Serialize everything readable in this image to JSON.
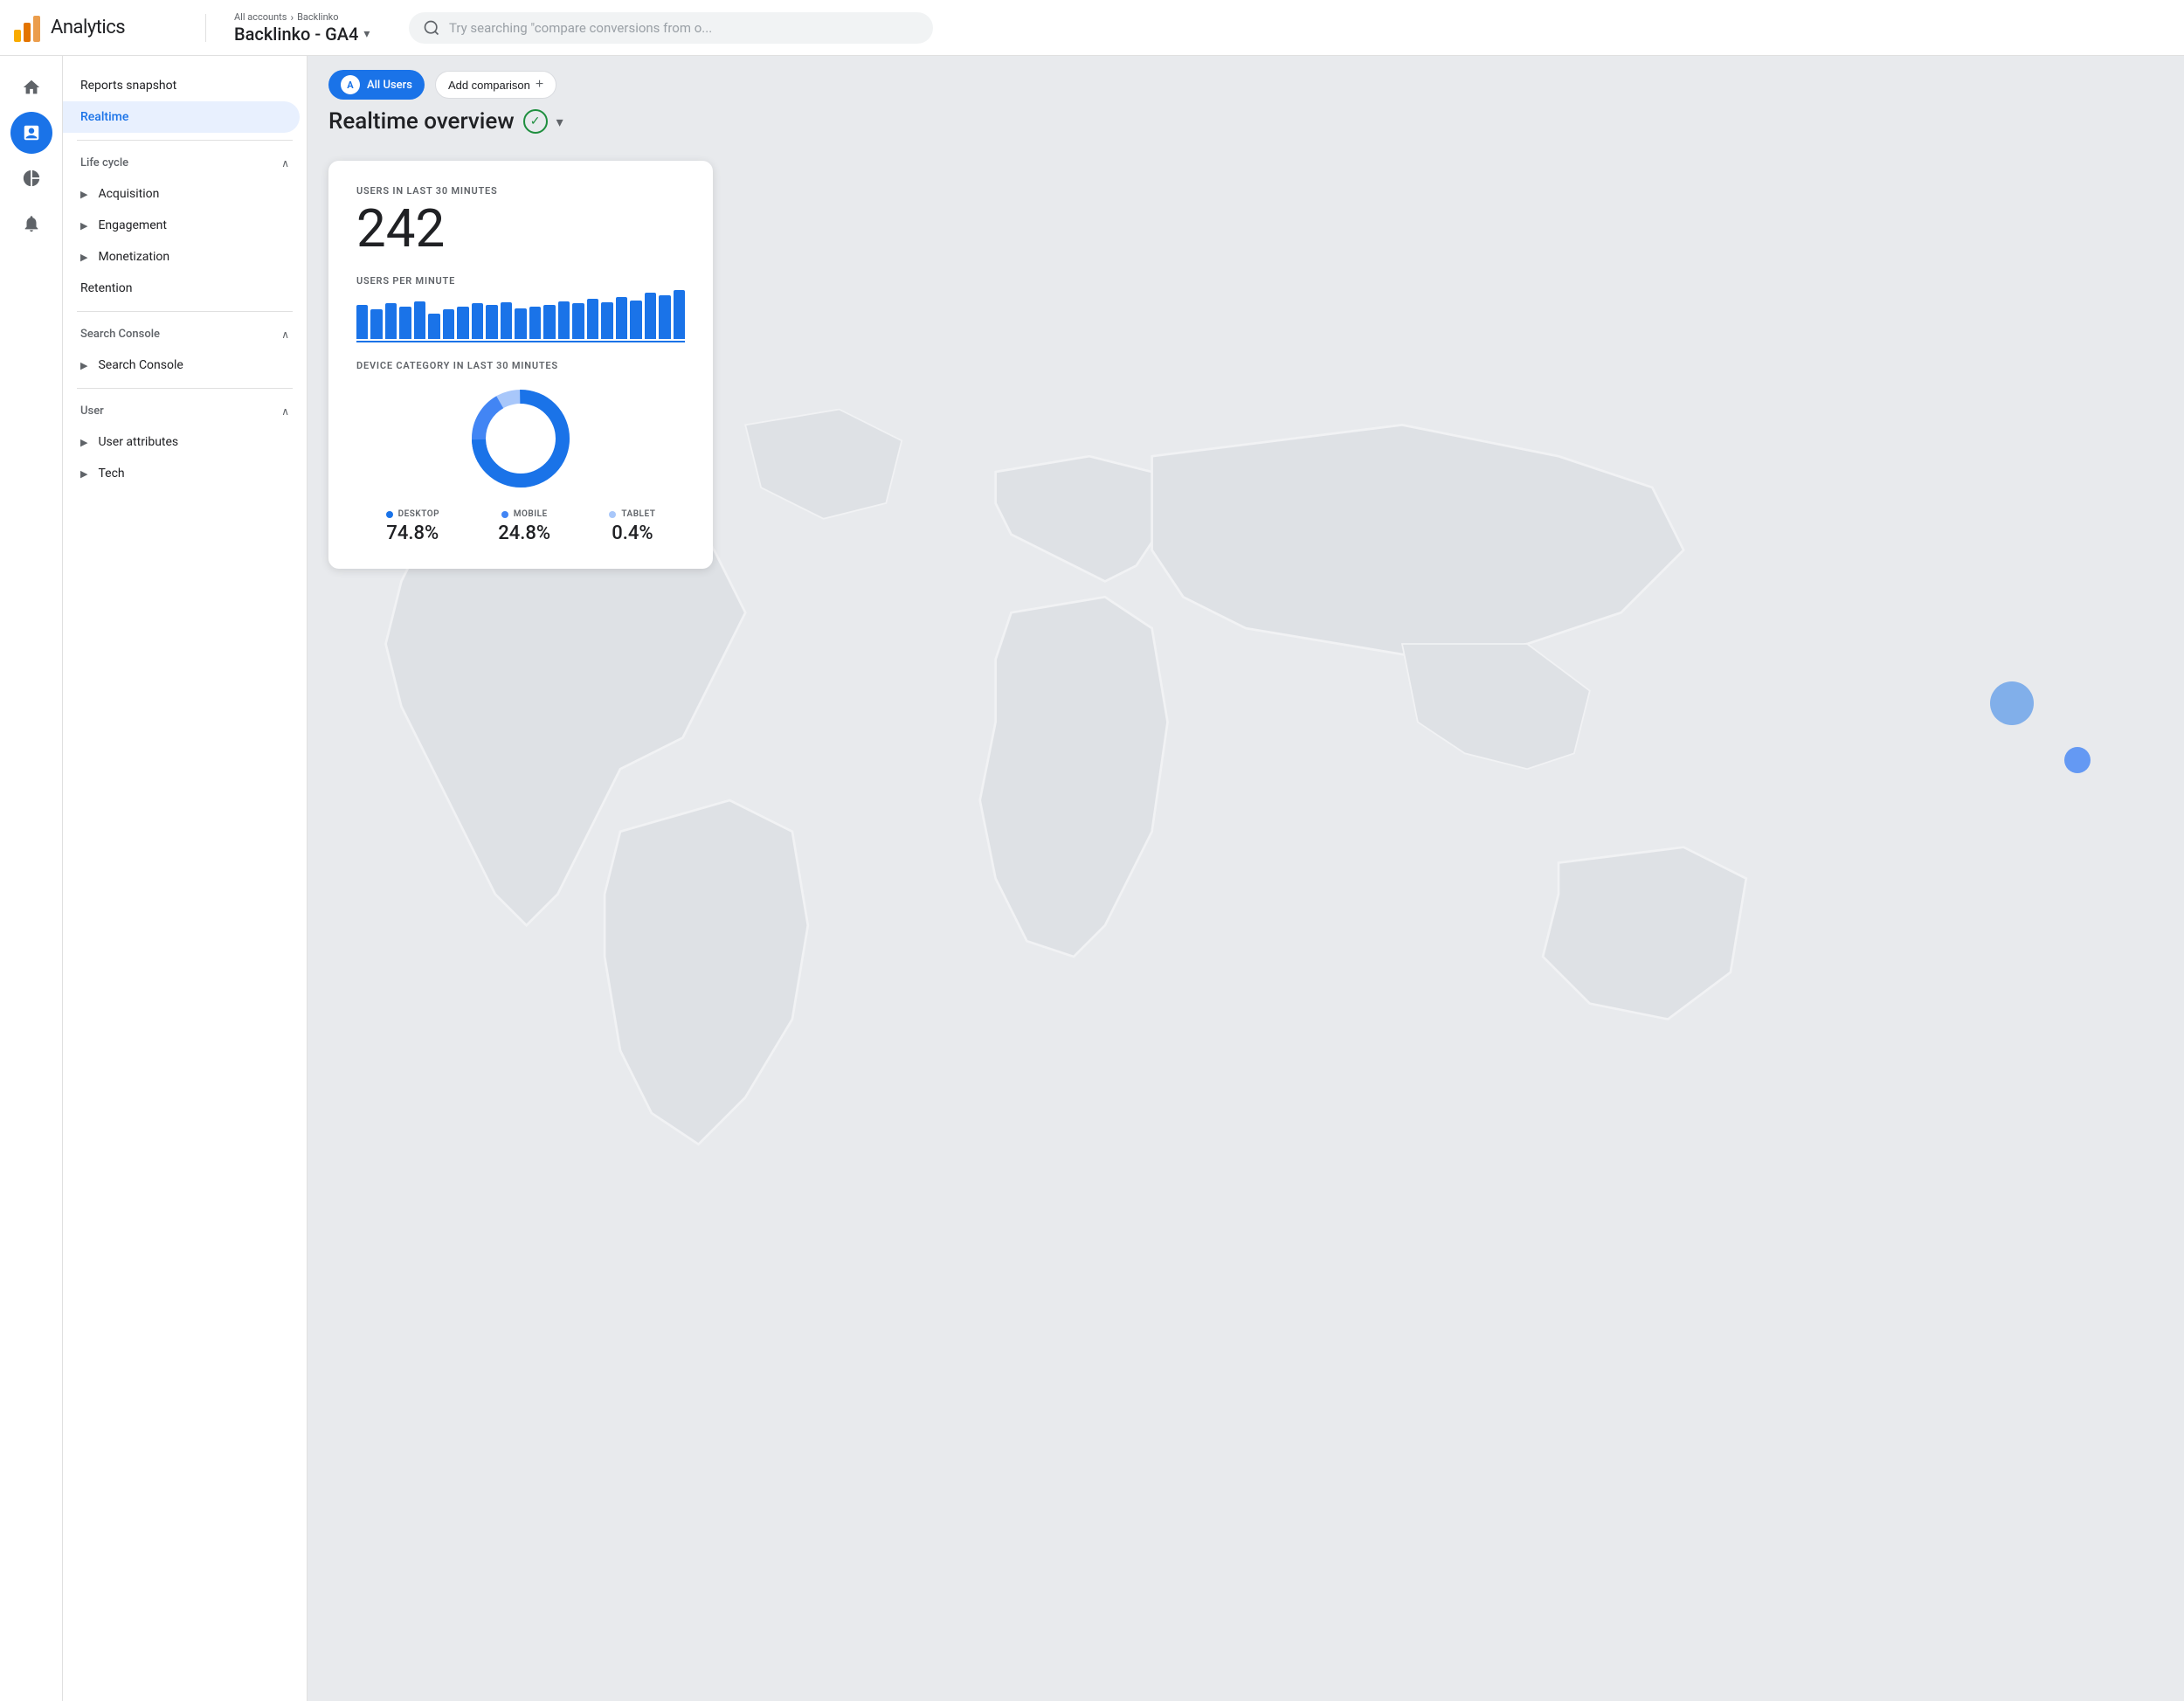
{
  "header": {
    "logo_alt": "Google Analytics logo",
    "title": "Analytics",
    "breadcrumb": {
      "accounts": "All accounts",
      "separator": "›",
      "account_name": "Backlinko"
    },
    "property": "Backlinko - GA4",
    "dropdown_label": "▾",
    "search_placeholder": "Try searching \"compare conversions from o..."
  },
  "icon_nav": [
    {
      "id": "home",
      "icon": "home",
      "active": false
    },
    {
      "id": "reports",
      "icon": "bar-chart",
      "active": true
    },
    {
      "id": "explore",
      "icon": "explore",
      "active": false
    },
    {
      "id": "advertising",
      "icon": "advertising",
      "active": false
    }
  ],
  "sidebar": {
    "reports_snapshot_label": "Reports snapshot",
    "realtime_label": "Realtime",
    "lifecycle": {
      "group_label": "Life cycle",
      "items": [
        {
          "id": "acquisition",
          "label": "Acquisition"
        },
        {
          "id": "engagement",
          "label": "Engagement"
        },
        {
          "id": "monetization",
          "label": "Monetization"
        },
        {
          "id": "retention",
          "label": "Retention"
        }
      ]
    },
    "search_console": {
      "group_label": "Search Console",
      "items": [
        {
          "id": "search-console",
          "label": "Search Console"
        }
      ]
    },
    "user": {
      "group_label": "User",
      "items": [
        {
          "id": "user-attributes",
          "label": "User attributes"
        },
        {
          "id": "tech",
          "label": "Tech"
        }
      ]
    }
  },
  "main": {
    "all_users_label": "All Users",
    "user_chip_avatar": "A",
    "add_comparison_label": "Add comparison",
    "add_comparison_plus": "+",
    "overview_title": "Realtime overview",
    "check_icon": "✓",
    "users_in_30_label": "USERS IN LAST 30 MINUTES",
    "users_count": "242",
    "users_per_minute_label": "USERS PER MINUTE",
    "device_category_label": "DEVICE CATEGORY IN LAST 30 MINUTES",
    "bar_heights": [
      40,
      35,
      42,
      38,
      45,
      30,
      35,
      38,
      42,
      40,
      44,
      36,
      38,
      40,
      45,
      42,
      48,
      44,
      50,
      46,
      55,
      52,
      58
    ],
    "donut": {
      "desktop_pct": 74.8,
      "mobile_pct": 24.8,
      "tablet_pct": 0.4,
      "desktop_color": "#1a73e8",
      "mobile_color": "#4285f4",
      "tablet_color": "#a8c7fa"
    },
    "legend": [
      {
        "id": "desktop",
        "label": "DESKTOP",
        "value": "74.8%",
        "color": "#1a73e8"
      },
      {
        "id": "mobile",
        "label": "MOBILE",
        "value": "24.8%",
        "color": "#4285f4"
      },
      {
        "id": "tablet",
        "label": "TABLET",
        "value": "0.4%",
        "color": "#a8c7fa"
      }
    ]
  }
}
